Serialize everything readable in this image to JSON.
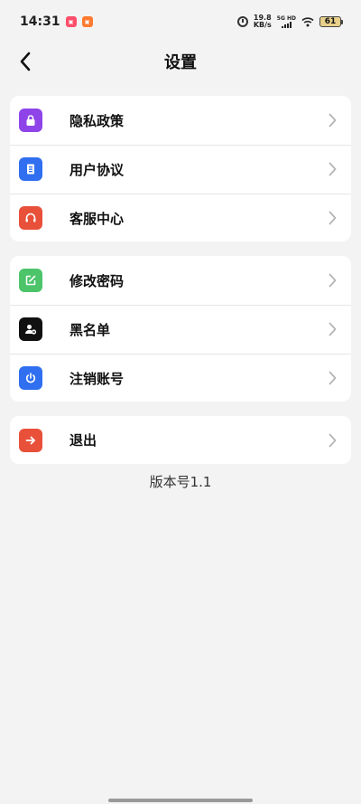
{
  "status_bar": {
    "time": "14:31",
    "net_speed_value": "19.8",
    "net_speed_unit": "KB/s",
    "signal_label": "5G HD",
    "battery": "61"
  },
  "header": {
    "title": "设置",
    "back_icon": "chevron-left-icon"
  },
  "groups": [
    {
      "items": [
        {
          "label": "隐私政策",
          "icon": "lock-icon",
          "color": "#8e44e8"
        },
        {
          "label": "用户协议",
          "icon": "document-icon",
          "color": "#2f6ff0"
        },
        {
          "label": "客服中心",
          "icon": "headphones-icon",
          "color": "#e8503a"
        }
      ]
    },
    {
      "items": [
        {
          "label": "修改密码",
          "icon": "edit-icon",
          "color": "#4cc46a"
        },
        {
          "label": "黑名单",
          "icon": "block-user-icon",
          "color": "#111111"
        },
        {
          "label": "注销账号",
          "icon": "power-icon",
          "color": "#2f6ff0"
        }
      ]
    },
    {
      "items": [
        {
          "label": "退出",
          "icon": "arrow-right-icon",
          "color": "#e8503a"
        }
      ]
    }
  ],
  "version": "版本号1.1"
}
